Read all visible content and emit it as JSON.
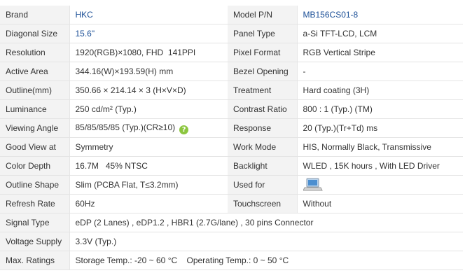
{
  "rows": [
    {
      "l1": "Brand",
      "v1": "HKC",
      "l2": "Model P/N",
      "v2": "MB156CS01-8"
    },
    {
      "l1": "Diagonal Size",
      "v1": "15.6\"",
      "l2": "Panel Type",
      "v2": "a-Si TFT-LCD, LCM"
    },
    {
      "l1": "Resolution",
      "v1": "1920(RGB)×1080, FHD  141PPI",
      "l2": "Pixel Format",
      "v2": "RGB Vertical Stripe"
    },
    {
      "l1": "Active Area",
      "v1": "344.16(W)×193.59(H) mm",
      "l2": "Bezel Opening",
      "v2": "-"
    },
    {
      "l1": "Outline(mm)",
      "v1": "350.66 × 214.14 × 3 (H×V×D)",
      "l2": "Treatment",
      "v2": "Hard coating (3H)"
    },
    {
      "l1": "Luminance",
      "v1": "250 cd/m² (Typ.)",
      "l2": "Contrast Ratio",
      "v2": "800 : 1 (Typ.) (TM)"
    },
    {
      "l1": "Viewing Angle",
      "v1": "85/85/85/85 (Typ.)(CR≥10)",
      "l2": "Response",
      "v2": "20 (Typ.)(Tr+Td) ms"
    },
    {
      "l1": "Good View at",
      "v1": "Symmetry",
      "l2": "Work Mode",
      "v2": "HIS, Normally Black, Transmissive"
    },
    {
      "l1": "Color Depth",
      "v1": "16.7M   45% NTSC",
      "l2": "Backlight",
      "v2": "WLED , 15K hours , With LED Driver"
    },
    {
      "l1": "Outline Shape",
      "v1": "Slim (PCBA Flat, T≤3.2mm)",
      "l2": "Used for",
      "v2": ""
    },
    {
      "l1": "Refresh Rate",
      "v1": "60Hz",
      "l2": "Touchscreen",
      "v2": "Without"
    },
    {
      "l1": "Signal Type",
      "v1": "eDP (2 Lanes) , eDP1.2 , HBR1 (2.7G/lane) , 30 pins Connector"
    },
    {
      "l1": "Voltage Supply",
      "v1": "3.3V (Typ.)"
    },
    {
      "l1": "Max. Ratings",
      "v1": "Storage Temp.: -20 ~ 60 °C    Operating Temp.: 0 ~ 50 °C"
    }
  ],
  "icons": {
    "viewing_angle_help": "question-icon",
    "used_for": "laptop-icon"
  },
  "colors": {
    "link": "#1a4e96",
    "label_bg": "#f3f3f3",
    "help_icon": "#8cc63f"
  }
}
